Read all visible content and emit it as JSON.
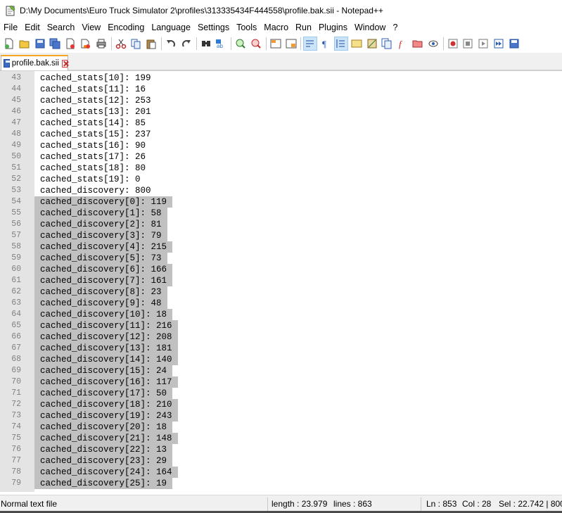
{
  "window": {
    "title": "D:\\My Documents\\Euro Truck Simulator 2\\profiles\\313335434F444558\\profile.bak.sii - Notepad++"
  },
  "menu": [
    "File",
    "Edit",
    "Search",
    "View",
    "Encoding",
    "Language",
    "Settings",
    "Tools",
    "Macro",
    "Run",
    "Plugins",
    "Window",
    "?"
  ],
  "toolbar": {
    "buttons": [
      "new-file-icon",
      "open-file-icon",
      "save-icon",
      "save-all-icon",
      "close-icon",
      "close-all-icon",
      "print-icon",
      "cut-icon",
      "copy-icon",
      "paste-icon",
      "undo-icon",
      "redo-icon",
      "find-icon",
      "replace-icon",
      "zoom-in-icon",
      "zoom-out-icon",
      "sync-vertical-icon",
      "sync-horizontal-icon",
      "word-wrap-icon",
      "show-all-chars-icon",
      "indent-guide-icon",
      "udl-icon",
      "doc-map-icon",
      "doc-list-icon",
      "function-list-icon",
      "folder-workspace-icon",
      "monitoring-icon",
      "record-macro-icon",
      "stop-macro-icon",
      "play-macro-icon",
      "run-macro-multiple-icon",
      "save-macro-icon"
    ],
    "active": [
      "word-wrap-icon",
      "indent-guide-icon"
    ]
  },
  "tab": {
    "label": "profile.bak.sii"
  },
  "colors": {
    "accent": "#f5a623",
    "selection": "#c0c0c0",
    "gutter": "#e4e4e4"
  },
  "editor": {
    "lines": [
      {
        "num": "43",
        "text": "cached_stats[10]: 199",
        "selected": false
      },
      {
        "num": "44",
        "text": "cached_stats[11]: 16",
        "selected": false
      },
      {
        "num": "45",
        "text": "cached_stats[12]: 253",
        "selected": false
      },
      {
        "num": "46",
        "text": "cached_stats[13]: 201",
        "selected": false
      },
      {
        "num": "47",
        "text": "cached_stats[14]: 85",
        "selected": false
      },
      {
        "num": "48",
        "text": "cached_stats[15]: 237",
        "selected": false
      },
      {
        "num": "49",
        "text": "cached_stats[16]: 90",
        "selected": false
      },
      {
        "num": "50",
        "text": "cached_stats[17]: 26",
        "selected": false
      },
      {
        "num": "51",
        "text": "cached_stats[18]: 80",
        "selected": false
      },
      {
        "num": "52",
        "text": "cached_stats[19]: 0",
        "selected": false
      },
      {
        "num": "53",
        "text": "cached_discovery: 800",
        "selected": false
      },
      {
        "num": "54",
        "text": "cached_discovery[0]: 119",
        "selected": true
      },
      {
        "num": "55",
        "text": "cached_discovery[1]: 58",
        "selected": true
      },
      {
        "num": "56",
        "text": "cached_discovery[2]: 81",
        "selected": true
      },
      {
        "num": "57",
        "text": "cached_discovery[3]: 79",
        "selected": true
      },
      {
        "num": "58",
        "text": "cached_discovery[4]: 215",
        "selected": true
      },
      {
        "num": "59",
        "text": "cached_discovery[5]: 73",
        "selected": true
      },
      {
        "num": "60",
        "text": "cached_discovery[6]: 166",
        "selected": true
      },
      {
        "num": "61",
        "text": "cached_discovery[7]: 161",
        "selected": true
      },
      {
        "num": "62",
        "text": "cached_discovery[8]: 23",
        "selected": true
      },
      {
        "num": "63",
        "text": "cached_discovery[9]: 48",
        "selected": true
      },
      {
        "num": "64",
        "text": "cached_discovery[10]: 18",
        "selected": true
      },
      {
        "num": "65",
        "text": "cached_discovery[11]: 216",
        "selected": true
      },
      {
        "num": "66",
        "text": "cached_discovery[12]: 208",
        "selected": true
      },
      {
        "num": "67",
        "text": "cached_discovery[13]: 181",
        "selected": true
      },
      {
        "num": "68",
        "text": "cached_discovery[14]: 140",
        "selected": true
      },
      {
        "num": "69",
        "text": "cached_discovery[15]: 24",
        "selected": true
      },
      {
        "num": "70",
        "text": "cached_discovery[16]: 117",
        "selected": true
      },
      {
        "num": "71",
        "text": "cached_discovery[17]: 50",
        "selected": true
      },
      {
        "num": "72",
        "text": "cached_discovery[18]: 210",
        "selected": true
      },
      {
        "num": "73",
        "text": "cached_discovery[19]: 243",
        "selected": true
      },
      {
        "num": "74",
        "text": "cached_discovery[20]: 18",
        "selected": true
      },
      {
        "num": "75",
        "text": "cached_discovery[21]: 148",
        "selected": true
      },
      {
        "num": "76",
        "text": "cached_discovery[22]: 13",
        "selected": true
      },
      {
        "num": "77",
        "text": "cached_discovery[23]: 29",
        "selected": true
      },
      {
        "num": "78",
        "text": "cached_discovery[24]: 164",
        "selected": true
      },
      {
        "num": "79",
        "text": "cached_discovery[25]: 19",
        "selected": true
      }
    ]
  },
  "status": {
    "file_type": "Normal text file",
    "length": "length : 23.979",
    "lines": "lines : 863",
    "ln": "Ln : 853",
    "col": "Col : 28",
    "sel": "Sel : 22.742 | 800"
  }
}
